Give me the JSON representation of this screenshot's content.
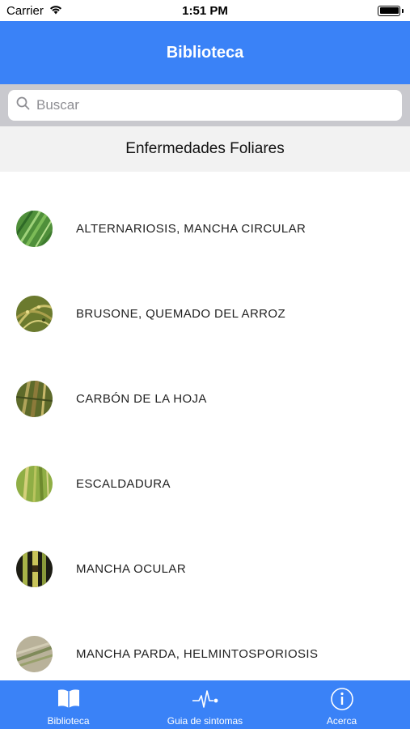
{
  "status_bar": {
    "carrier": "Carrier",
    "time": "1:51 PM"
  },
  "nav": {
    "title": "Biblioteca"
  },
  "search": {
    "placeholder": "Buscar"
  },
  "section": {
    "title": "Enfermedades Foliares"
  },
  "items": [
    {
      "label": "ALTERNARIOSIS, MANCHA CIRCULAR",
      "icon": "leaf-thumbnail"
    },
    {
      "label": "BRUSONE, QUEMADO DEL ARROZ",
      "icon": "rice-panicle-thumbnail"
    },
    {
      "label": "CARBÓN DE LA HOJA",
      "icon": "leaf-smut-thumbnail"
    },
    {
      "label": "ESCALDADURA",
      "icon": "leaf-scald-thumbnail"
    },
    {
      "label": "MANCHA OCULAR",
      "icon": "eyespot-thumbnail"
    },
    {
      "label": "MANCHA PARDA, HELMINTOSPORIOSIS",
      "icon": "brown-spot-thumbnail"
    }
  ],
  "tabs": [
    {
      "label": "Biblioteca",
      "icon": "book-icon"
    },
    {
      "label": "Guia de sintomas",
      "icon": "pulse-icon"
    },
    {
      "label": "Acerca",
      "icon": "info-icon"
    }
  ],
  "colors": {
    "accent": "#3a82f7",
    "search_bg": "#c9c9ce",
    "section_bg": "#f2f2f2"
  }
}
